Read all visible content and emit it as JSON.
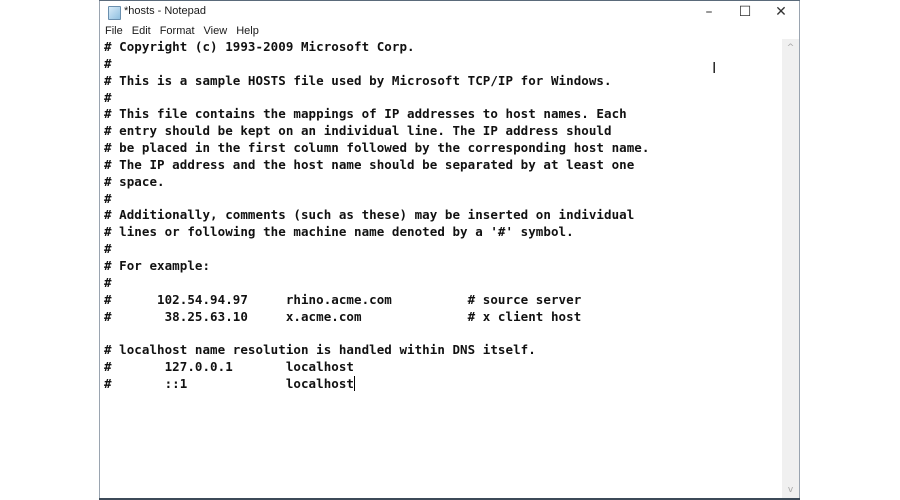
{
  "window": {
    "title": "*hosts - Notepad",
    "controls": {
      "minimize": "–",
      "maximize": "☐",
      "close": "✕"
    }
  },
  "menubar": {
    "items": [
      {
        "label": "File"
      },
      {
        "label": "Edit"
      },
      {
        "label": "Format"
      },
      {
        "label": "View"
      },
      {
        "label": "Help"
      }
    ]
  },
  "editor": {
    "lines": [
      "# Copyright (c) 1993-2009 Microsoft Corp.",
      "#",
      "# This is a sample HOSTS file used by Microsoft TCP/IP for Windows.",
      "#",
      "# This file contains the mappings of IP addresses to host names. Each",
      "# entry should be kept on an individual line. The IP address should",
      "# be placed in the first column followed by the corresponding host name.",
      "# The IP address and the host name should be separated by at least one",
      "# space.",
      "#",
      "# Additionally, comments (such as these) may be inserted on individual",
      "# lines or following the machine name denoted by a '#' symbol.",
      "#",
      "# For example:",
      "#",
      "#      102.54.94.97     rhino.acme.com          # source server",
      "#       38.25.63.10     x.acme.com              # x client host",
      "",
      "# localhost name resolution is handled within DNS itself.",
      "#       127.0.0.1       localhost",
      "#       ::1             localhost"
    ],
    "caret_line": 20
  },
  "scrollbar": {
    "up": "^",
    "down": "v"
  },
  "cursor": {
    "icon": "I"
  }
}
